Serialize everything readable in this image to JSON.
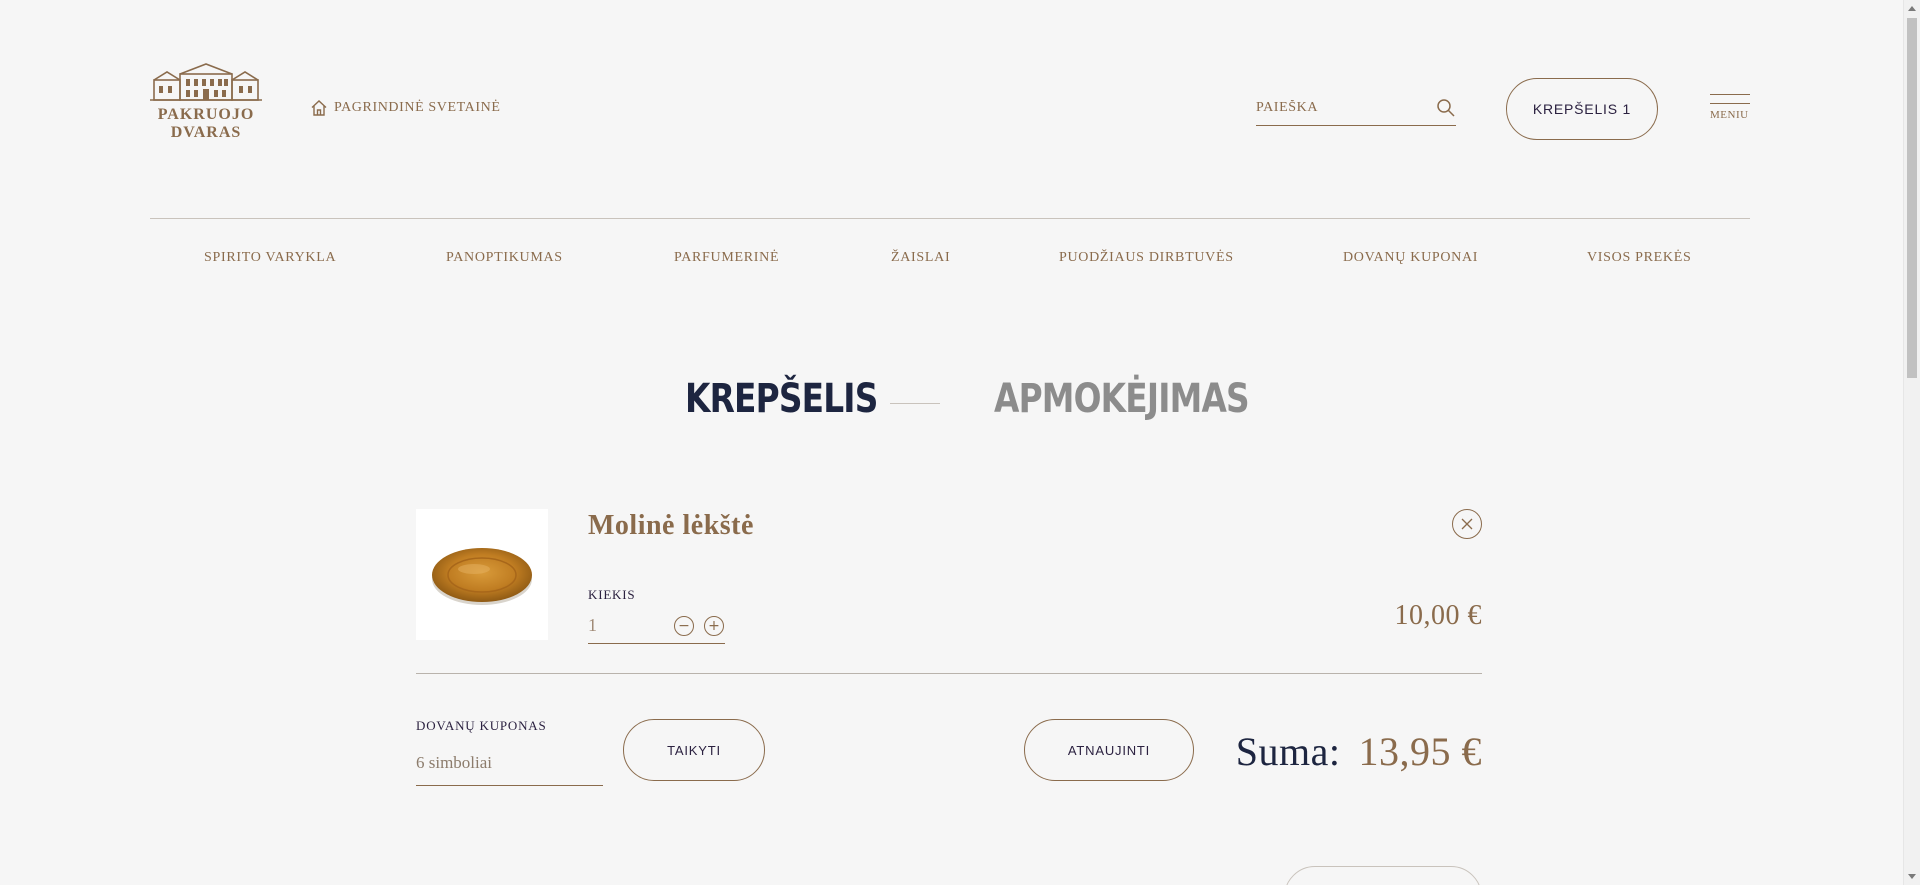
{
  "header": {
    "logo_line1": "PAKRUOJO",
    "logo_line2": "DVARAS",
    "home_link": "PAGRINDINĖ SVETAINĖ",
    "search_placeholder": "PAIEŠKA",
    "cart_button": "KREPŠELIS 1",
    "menu_label": "MENIU"
  },
  "nav": {
    "items": [
      "SPIRITO VARYKLA",
      "PANOPTIKUMAS",
      "PARFUMERINĖ",
      "ŽAISLAI",
      "PUODŽIAUS DIRBTUVĖS",
      "DOVANŲ KUPONAI",
      "VISOS PREKĖS"
    ]
  },
  "steps": {
    "active": "KREPŠELIS",
    "inactive": "APMOKĖJIMAS"
  },
  "cart": {
    "item": {
      "title": "Molinė lėkštė",
      "qty_label": "KIEKIS",
      "qty_value": "1",
      "qty_minus": "−",
      "qty_plus": "+",
      "price": "10,00 €"
    },
    "coupon_label": "DOVANŲ KUPONAS",
    "coupon_placeholder": "6 simboliai",
    "apply_button": "TAIKYTI",
    "update_button": "ATNAUJINTI",
    "total_label": "Suma:",
    "total_value": "13,95 €"
  },
  "colors": {
    "accent": "#8a6b4c",
    "dark": "#1d2540",
    "background": "#f6f6f6"
  }
}
